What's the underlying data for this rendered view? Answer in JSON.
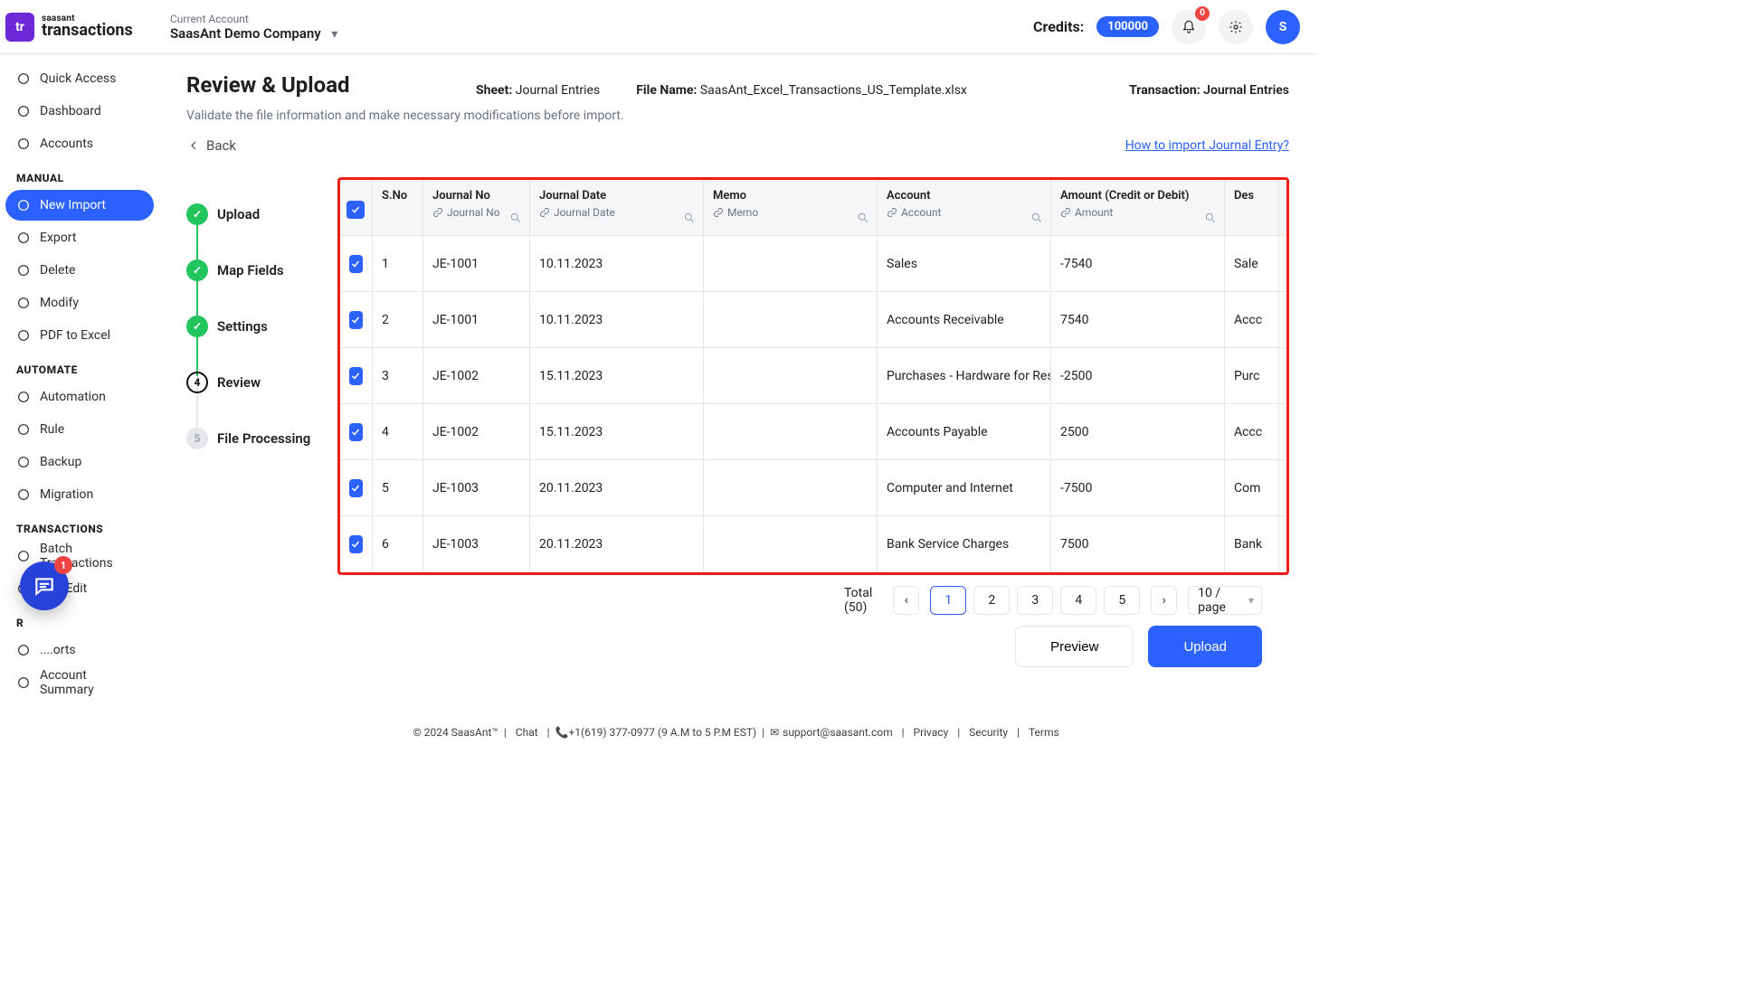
{
  "brand": {
    "badge": "tr",
    "sup": "saasant",
    "main": "transactions"
  },
  "account": {
    "label": "Current Account",
    "value": "SaasAnt Demo Company"
  },
  "credits": {
    "label": "Credits:",
    "value": "100000"
  },
  "notif_count": "0",
  "avatar_letter": "S",
  "sidebar": {
    "sections": [
      {
        "title": null,
        "items": [
          {
            "label": "Quick Access",
            "icon": "clock-icon"
          },
          {
            "label": "Dashboard",
            "icon": "home-icon"
          },
          {
            "label": "Accounts",
            "icon": "layers-icon"
          }
        ]
      },
      {
        "title": "MANUAL",
        "items": [
          {
            "label": "New Import",
            "icon": "plus-circle-icon",
            "active": true
          },
          {
            "label": "Export",
            "icon": "download-icon"
          },
          {
            "label": "Delete",
            "icon": "trash-icon"
          },
          {
            "label": "Modify",
            "icon": "edit-icon"
          },
          {
            "label": "PDF to Excel",
            "icon": "file-icon"
          }
        ]
      },
      {
        "title": "AUTOMATE",
        "items": [
          {
            "label": "Automation",
            "icon": "share-icon"
          },
          {
            "label": "Rule",
            "icon": "sliders-icon"
          },
          {
            "label": "Backup",
            "icon": "box-icon"
          },
          {
            "label": "Migration",
            "icon": "refresh-icon"
          }
        ]
      },
      {
        "title": "TRANSACTIONS",
        "items": [
          {
            "label": "Batch Transactions",
            "icon": "list-icon"
          },
          {
            "label": "Live Edit",
            "icon": "pencil-icon"
          }
        ]
      },
      {
        "title": "R",
        "items": [
          {
            "label": "....orts",
            "icon": "report-icon"
          },
          {
            "label": "Account Summary",
            "icon": "summary-icon"
          }
        ]
      }
    ]
  },
  "page": {
    "title": "Review & Upload",
    "sheet_label": "Sheet:",
    "sheet_value": "Journal Entries",
    "file_label": "File Name:",
    "file_value": "SaasAnt_Excel_Transactions_US_Template.xlsx",
    "txn_label": "Transaction:",
    "txn_value": "Journal Entries",
    "subtitle": "Validate the file information and make necessary modifications before import.",
    "back": "Back",
    "howto": "How to import Journal Entry?"
  },
  "steps": [
    {
      "label": "Upload",
      "state": "done",
      "mark": "✓"
    },
    {
      "label": "Map Fields",
      "state": "done",
      "mark": "✓"
    },
    {
      "label": "Settings",
      "state": "done",
      "mark": "✓"
    },
    {
      "label": "Review",
      "state": "current",
      "mark": "4"
    },
    {
      "label": "File Processing",
      "state": "pending",
      "mark": "5"
    }
  ],
  "columns": [
    {
      "key": "sno",
      "label": "S.No",
      "map": null,
      "search": false,
      "wclass": "w-sno"
    },
    {
      "key": "jno",
      "label": "Journal No",
      "map": "Journal No",
      "search": true,
      "wclass": "w-jno"
    },
    {
      "key": "jdate",
      "label": "Journal Date",
      "map": "Journal Date",
      "search": true,
      "wclass": "w-jdate"
    },
    {
      "key": "memo",
      "label": "Memo",
      "map": "Memo",
      "search": true,
      "wclass": "w-memo"
    },
    {
      "key": "acct",
      "label": "Account",
      "map": "Account",
      "search": true,
      "wclass": "w-acct"
    },
    {
      "key": "amt",
      "label": "Amount (Credit or Debit)",
      "map": "Amount",
      "search": true,
      "wclass": "w-amt"
    },
    {
      "key": "desc",
      "label": "Des",
      "map": null,
      "search": false,
      "wclass": "w-desc"
    }
  ],
  "rows": [
    {
      "sno": "1",
      "jno": "JE-1001",
      "jdate": "10.11.2023",
      "memo": "",
      "acct": "Sales",
      "amt": "-7540",
      "desc": "Sale"
    },
    {
      "sno": "2",
      "jno": "JE-1001",
      "jdate": "10.11.2023",
      "memo": "",
      "acct": "Accounts Receivable",
      "amt": "7540",
      "desc": "Accc"
    },
    {
      "sno": "3",
      "jno": "JE-1002",
      "jdate": "15.11.2023",
      "memo": "",
      "acct": "Purchases - Hardware for Resa",
      "amt": "-2500",
      "desc": "Purc"
    },
    {
      "sno": "4",
      "jno": "JE-1002",
      "jdate": "15.11.2023",
      "memo": "",
      "acct": "Accounts Payable",
      "amt": "2500",
      "desc": "Accc"
    },
    {
      "sno": "5",
      "jno": "JE-1003",
      "jdate": "20.11.2023",
      "memo": "",
      "acct": "Computer and Internet",
      "amt": "-7500",
      "desc": "Com"
    },
    {
      "sno": "6",
      "jno": "JE-1003",
      "jdate": "20.11.2023",
      "memo": "",
      "acct": "Bank Service Charges",
      "amt": "7500",
      "desc": "Bank"
    }
  ],
  "pager": {
    "total_label": "Total (50)",
    "pages": [
      "1",
      "2",
      "3",
      "4",
      "5"
    ],
    "page_size": "10 / page"
  },
  "actions": {
    "preview": "Preview",
    "upload": "Upload"
  },
  "footer": {
    "copy": "© 2024 SaasAnt™",
    "chat": "Chat",
    "phone": "+1(619) 377-0977 (9 A.M to 5 P.M EST)",
    "email": "support@saasant.com",
    "links": [
      "Privacy",
      "Security",
      "Terms"
    ]
  },
  "chat_badge": "1"
}
